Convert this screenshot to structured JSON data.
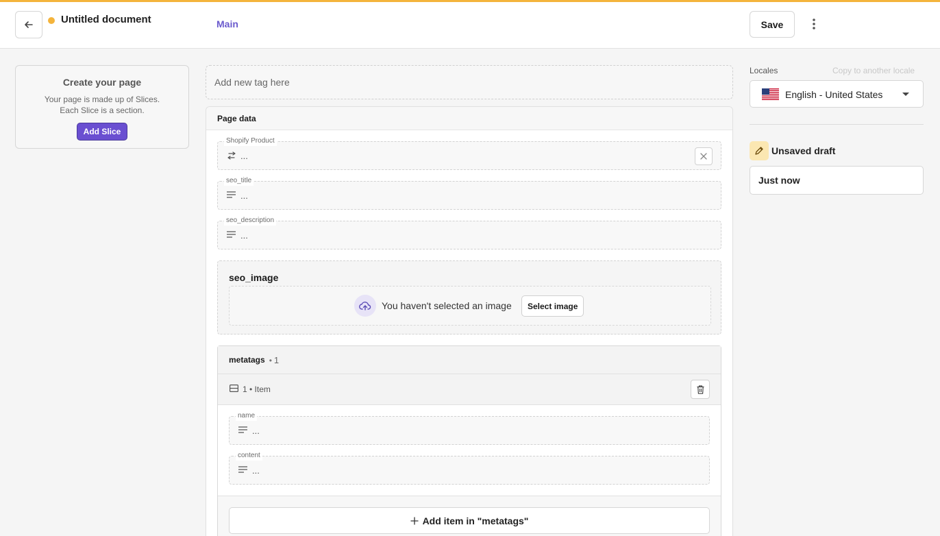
{
  "header": {
    "back_icon": "arrow-left-icon",
    "document_title": "Untitled document",
    "status_color": "#f4b43c",
    "branch": "Main",
    "save_label": "Save",
    "more_icon": "more-vertical-icon"
  },
  "create_card": {
    "title": "Create your page",
    "description_line1": "Your page is made up of Slices.",
    "description_line2": "Each Slice is a section.",
    "add_slice_label": "Add Slice"
  },
  "tags": {
    "placeholder": "Add new tag here"
  },
  "page_data": {
    "title": "Page data",
    "fields": [
      {
        "label": "Shopify Product",
        "value": "...",
        "icon": "integration-icon"
      },
      {
        "label": "seo_title",
        "value": "...",
        "icon": "text-icon"
      },
      {
        "label": "seo_description",
        "value": "...",
        "icon": "text-icon"
      }
    ],
    "seo_image": {
      "title": "seo_image",
      "empty_text": "You haven't selected an image",
      "select_label": "Select image"
    },
    "metatags": {
      "title": "metatags",
      "separator": "•",
      "count": "1",
      "item_label": "1 • Item",
      "fields": [
        {
          "label": "name",
          "value": "..."
        },
        {
          "label": "content",
          "value": "..."
        }
      ],
      "add_label": "Add item in \"metatags\""
    }
  },
  "sidebar": {
    "locales_label": "Locales",
    "copy_locale_label": "Copy to another locale",
    "locale_value": "English - United States",
    "draft_label": "Unsaved draft",
    "draft_time": "Just now"
  },
  "colors": {
    "accent": "#6a4fd1",
    "warning": "#f4b43c"
  }
}
